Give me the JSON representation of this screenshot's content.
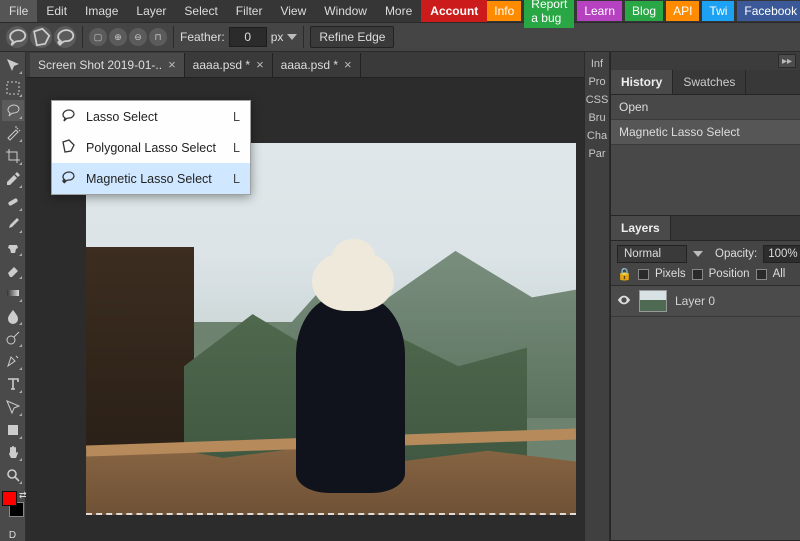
{
  "menu": {
    "items": [
      "File",
      "Edit",
      "Image",
      "Layer",
      "Select",
      "Filter",
      "View",
      "Window",
      "More"
    ],
    "account": "Account",
    "right": [
      {
        "k": "info",
        "label": "Info",
        "bg": "#ff8c00"
      },
      {
        "k": "bug",
        "label": "Report a bug",
        "bg": "#2aa745"
      },
      {
        "k": "learn",
        "label": "Learn",
        "bg": "#b642c2"
      },
      {
        "k": "blog",
        "label": "Blog",
        "bg": "#2aa745"
      },
      {
        "k": "api",
        "label": "API",
        "bg": "#ff8c00"
      },
      {
        "k": "twi",
        "label": "Twi",
        "bg": "#1da1f2"
      },
      {
        "k": "fb",
        "label": "Facebook",
        "bg": "#3b5998"
      }
    ]
  },
  "optbar": {
    "feather_label": "Feather:",
    "feather_value": "0",
    "feather_unit": "px",
    "refine": "Refine Edge"
  },
  "tabs": [
    {
      "name": "Screen Shot 2019-01-..",
      "dirty": false,
      "active": true
    },
    {
      "name": "aaaa.psd *",
      "dirty": true,
      "active": false
    },
    {
      "name": "aaaa.psd *",
      "dirty": true,
      "active": false
    }
  ],
  "flyout": [
    {
      "icon": "lasso",
      "label": "Lasso Select",
      "key": "L",
      "sel": false
    },
    {
      "icon": "poly",
      "label": "Polygonal Lasso Select",
      "key": "L",
      "sel": false
    },
    {
      "icon": "mag",
      "label": "Magnetic Lasso Select",
      "key": "L",
      "sel": true
    }
  ],
  "rstrip": [
    "Inf",
    "Pro",
    "CSS",
    "Bru",
    "Cha",
    "Par"
  ],
  "history": {
    "tabs": [
      "History",
      "Swatches"
    ],
    "rows": [
      "Open",
      "Magnetic Lasso Select"
    ]
  },
  "layers": {
    "title": "Layers",
    "blend": "Normal",
    "opacity_label": "Opacity:",
    "opacity_value": "100%",
    "lock_labels": {
      "pixels": "Pixels",
      "position": "Position",
      "all": "All"
    },
    "items": [
      {
        "name": "Layer 0",
        "visible": true
      }
    ]
  },
  "tools": [
    "move",
    "marquee",
    "lasso",
    "wand",
    "crop",
    "eyedropper",
    "heal",
    "brush",
    "clone",
    "eraser",
    "gradient",
    "blur",
    "dodge",
    "pen",
    "type",
    "path",
    "shape",
    "hand",
    "zoom"
  ],
  "swatch_label": "D"
}
